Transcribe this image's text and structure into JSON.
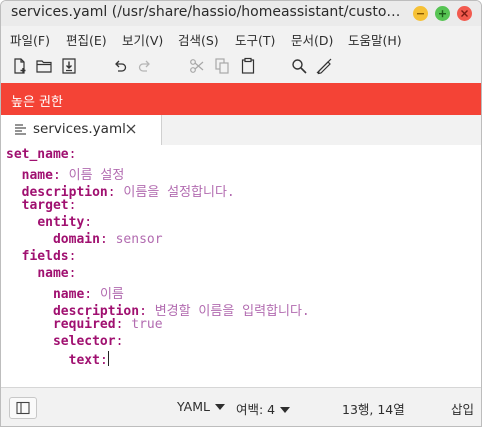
{
  "window": {
    "title": "services.yaml (/usr/share/hassio/homeassistant/custom_c…"
  },
  "menu": [
    "파일(F)",
    "편집(E)",
    "보기(V)",
    "검색(S)",
    "도구(T)",
    "문서(D)",
    "도움말(H)"
  ],
  "toolbar": {
    "icons": [
      "new-document-icon",
      "open-folder-icon",
      "save-icon",
      "undo-icon",
      "redo-icon",
      "cut-icon",
      "copy-icon",
      "paste-icon",
      "search-icon",
      "spellcheck-icon"
    ]
  },
  "banner": {
    "text": "높은 권한",
    "color": "#f44336"
  },
  "tab": {
    "label": "services.yaml"
  },
  "editor": {
    "lines": [
      {
        "indent": "",
        "key": "set_name",
        "value": ""
      },
      {
        "indent": "  ",
        "key": "name",
        "value": "이름 설정"
      },
      {
        "indent": "  ",
        "key": "description",
        "value": "이름을 설정합니다."
      },
      {
        "indent": "  ",
        "key": "target",
        "value": ""
      },
      {
        "indent": "    ",
        "key": "entity",
        "value": ""
      },
      {
        "indent": "      ",
        "key": "domain",
        "value": "sensor"
      },
      {
        "indent": "  ",
        "key": "fields",
        "value": ""
      },
      {
        "indent": "    ",
        "key": "name",
        "value": ""
      },
      {
        "indent": "      ",
        "key": "name",
        "value": "이름"
      },
      {
        "indent": "      ",
        "key": "description",
        "value": "변경할 이름을 입력합니다."
      },
      {
        "indent": "      ",
        "key": "required",
        "value": "true"
      },
      {
        "indent": "      ",
        "key": "selector",
        "value": ""
      },
      {
        "indent": "        ",
        "key": "text",
        "value": ""
      }
    ]
  },
  "status": {
    "language": "YAML",
    "margin": "여백: 4",
    "position": "13행, 14열",
    "mode": "삽입"
  }
}
